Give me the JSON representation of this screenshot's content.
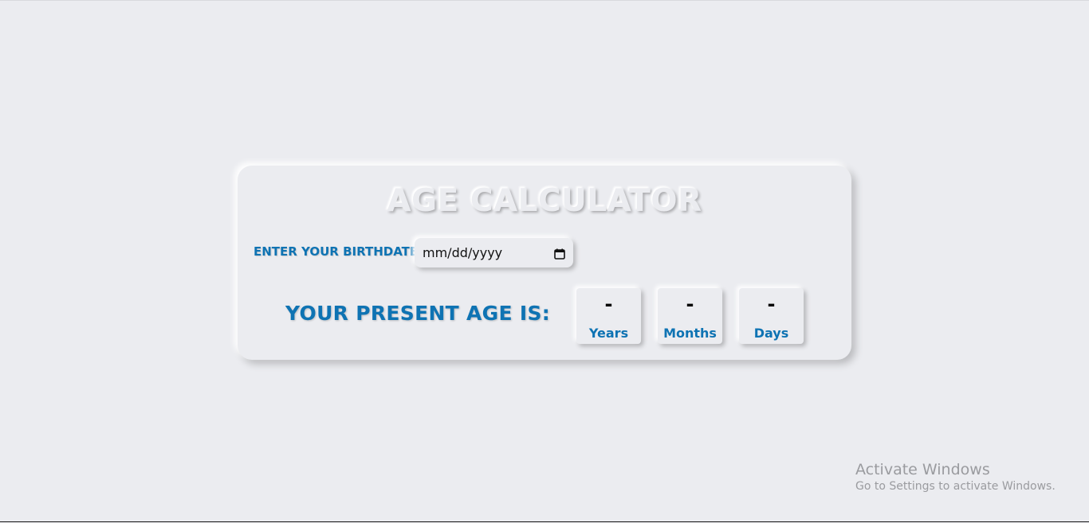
{
  "title": "AGE CALCULATOR",
  "birthdate": {
    "label": "ENTER YOUR BIRTHDATE:",
    "placeholder": "mm/dd/yyyy",
    "icon": "calendar-icon"
  },
  "result": {
    "label": "YOUR PRESENT AGE IS:",
    "years": {
      "value": "-",
      "unit": "Years"
    },
    "months": {
      "value": "-",
      "unit": "Months"
    },
    "days": {
      "value": "-",
      "unit": "Days"
    }
  },
  "watermark": {
    "title": "Activate Windows",
    "subtitle": "Go to Settings to activate Windows."
  },
  "colors": {
    "background": "#ebecf0",
    "accent": "#0e73b3"
  }
}
